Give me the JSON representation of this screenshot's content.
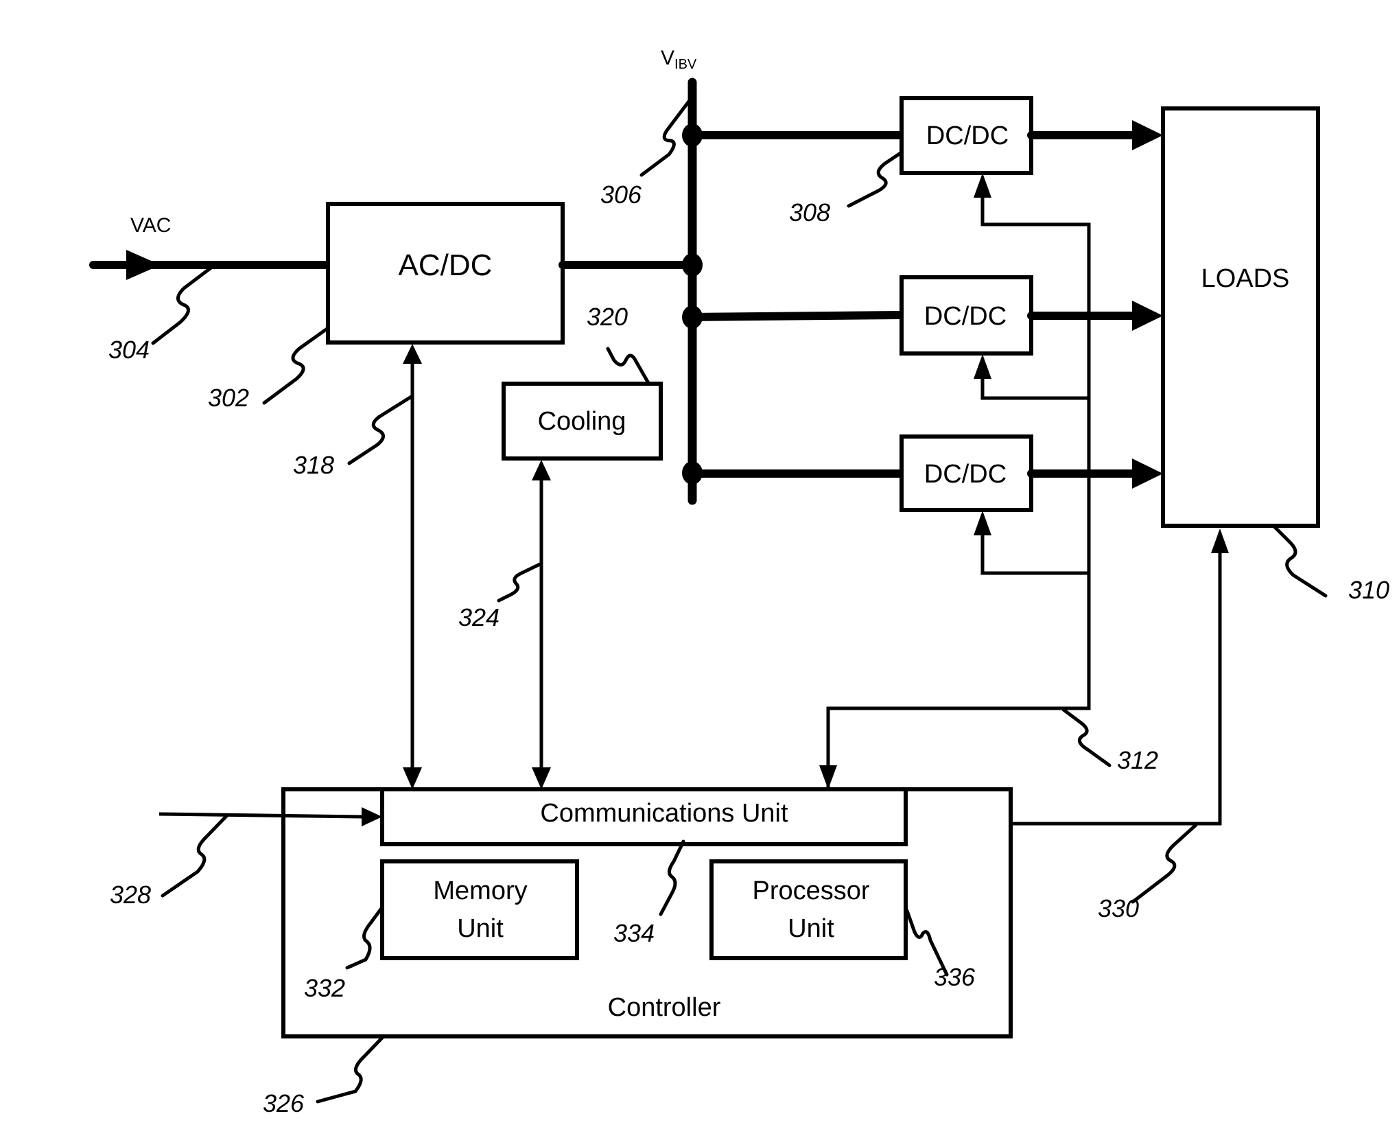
{
  "diagram": {
    "signals": {
      "vac": "VAC",
      "vibv_main": "V",
      "vibv_sub": "IBV"
    },
    "blocks": {
      "acdc": "AC/DC",
      "dcdc_1": "DC/DC",
      "dcdc_2": "DC/DC",
      "dcdc_3": "DC/DC",
      "loads": "LOADS",
      "cooling": "Cooling",
      "comm_unit": "Communications Unit",
      "memory_line1": "Memory",
      "memory_line2": "Unit",
      "processor_line1": "Processor",
      "processor_line2": "Unit",
      "controller": "Controller"
    },
    "refs": {
      "r302": "302",
      "r304": "304",
      "r306": "306",
      "r308": "308",
      "r310": "310",
      "r312": "312",
      "r318": "318",
      "r320": "320",
      "r324": "324",
      "r326": "326",
      "r328": "328",
      "r330": "330",
      "r332": "332",
      "r334": "334",
      "r336": "336"
    }
  }
}
